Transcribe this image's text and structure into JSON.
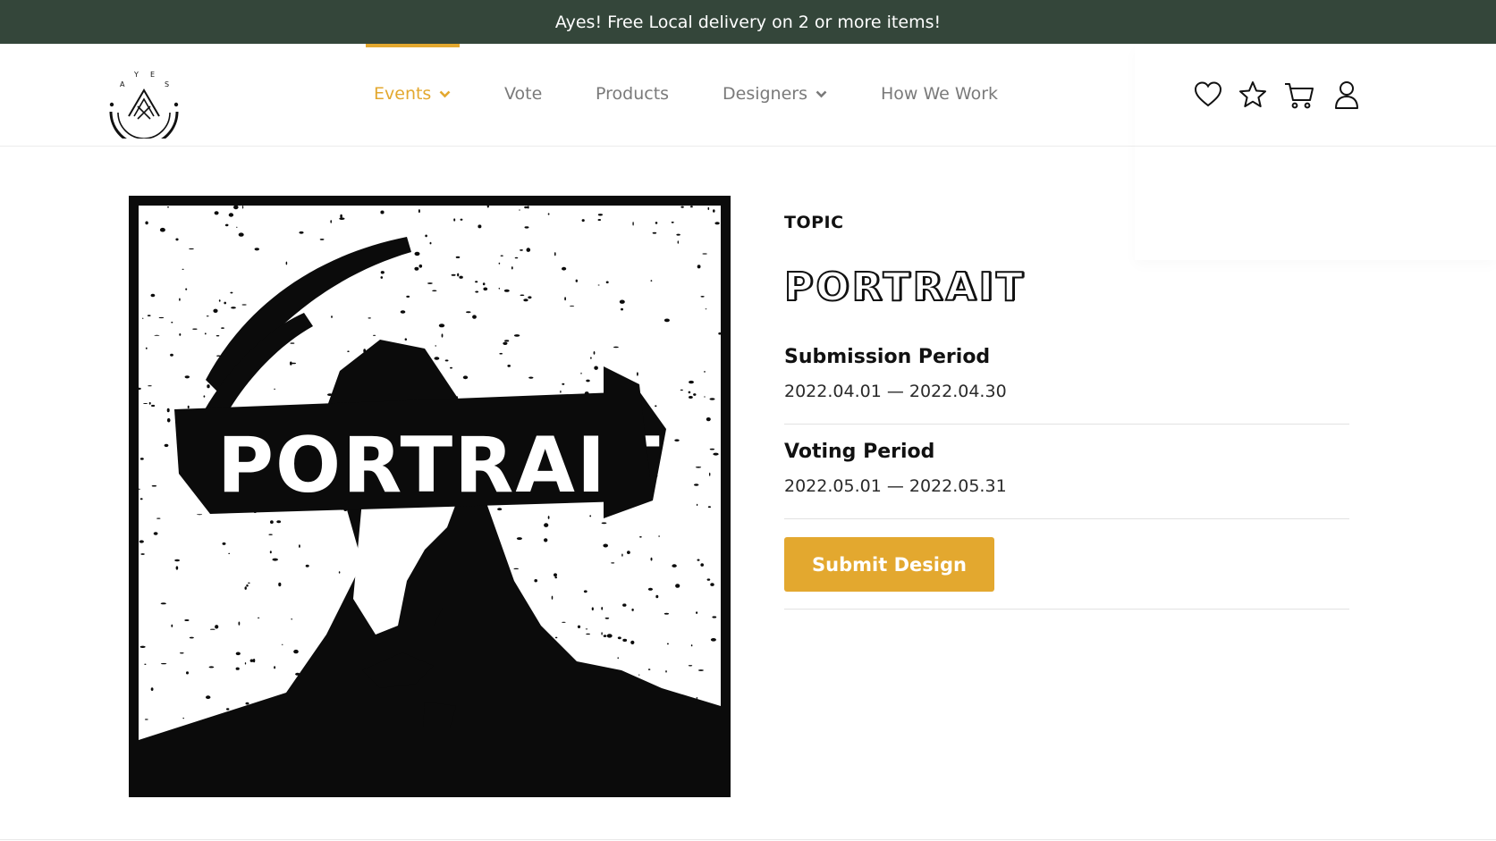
{
  "promo": {
    "text": "Ayes! Free Local delivery on 2 or more items!"
  },
  "header": {
    "logo_letters": [
      "A",
      "Y",
      "E",
      "S"
    ],
    "nav": [
      {
        "label": "Events",
        "active": true,
        "has_dropdown": true
      },
      {
        "label": "Vote",
        "active": false,
        "has_dropdown": false
      },
      {
        "label": "Products",
        "active": false,
        "has_dropdown": false
      },
      {
        "label": "Designers",
        "active": false,
        "has_dropdown": true
      },
      {
        "label": "How We Work",
        "active": false,
        "has_dropdown": false
      }
    ],
    "icons": [
      "heart-icon",
      "star-icon",
      "cart-icon",
      "user-icon"
    ]
  },
  "artwork": {
    "text": "PORTRAIT"
  },
  "topic": {
    "label": "TOPIC",
    "title": "PORTRAIT",
    "submission": {
      "title": "Submission Period",
      "dates": "2022.04.01 — 2022.04.30"
    },
    "voting": {
      "title": "Voting Period",
      "dates": "2022.05.01 — 2022.05.31"
    },
    "submit_label": "Submit Design"
  },
  "colors": {
    "promo_bg": "#34463a",
    "accent": "#e3a82f",
    "nav_text": "#7a7a7a"
  }
}
